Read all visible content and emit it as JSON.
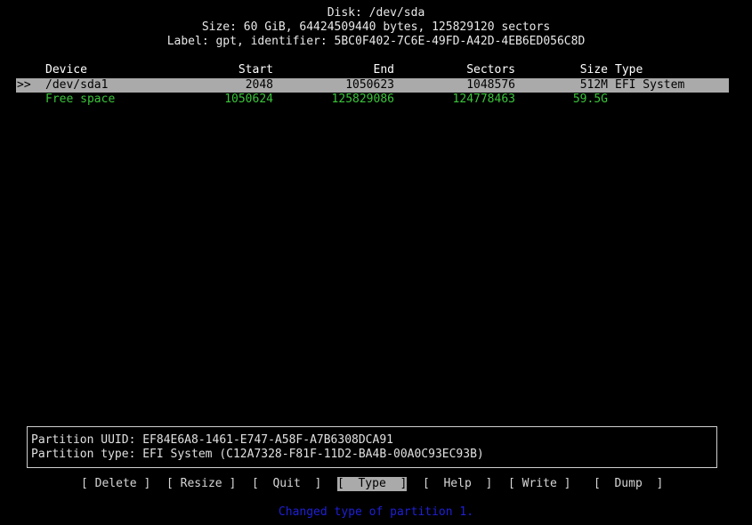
{
  "header": {
    "title": "Disk: /dev/sda",
    "size_line": "Size: 60 GiB, 64424509440 bytes, 125829120 sectors",
    "label_line": "Label: gpt, identifier: 5BC0F402-7C6E-49FD-A42D-4EB6ED056C8D"
  },
  "table": {
    "columns": {
      "device": "Device",
      "start": "Start",
      "end": "End",
      "sectors": "Sectors",
      "size": "Size",
      "type": "Type"
    },
    "rows": [
      {
        "marker": ">>",
        "device": "/dev/sda1",
        "start": "2048",
        "end": "1050623",
        "sectors": "1048576",
        "size": "512M",
        "type": "EFI System"
      },
      {
        "marker": "",
        "device": "Free space",
        "start": "1050624",
        "end": "125829086",
        "sectors": "124778463",
        "size": "59.5G",
        "type": ""
      }
    ]
  },
  "info": {
    "uuid_line": "Partition UUID: EF84E6A8-1461-E747-A58F-A7B6308DCA91",
    "type_line": "Partition type: EFI System (C12A7328-F81F-11D2-BA4B-00A0C93EC93B)"
  },
  "menu": {
    "delete": "[ Delete ]",
    "resize": "[ Resize ]",
    "quit": "[  Quit  ]",
    "type": "[  Type  ]",
    "help": "[  Help  ]",
    "write": "[ Write ]",
    "dump": "[  Dump  ]",
    "selected": "Type"
  },
  "status": {
    "message": "Changed type of partition 1."
  },
  "colors": {
    "background": "#000000",
    "selection": "#aaaaaa",
    "free_space": "#38c538",
    "status_text": "#1f1fd8"
  }
}
